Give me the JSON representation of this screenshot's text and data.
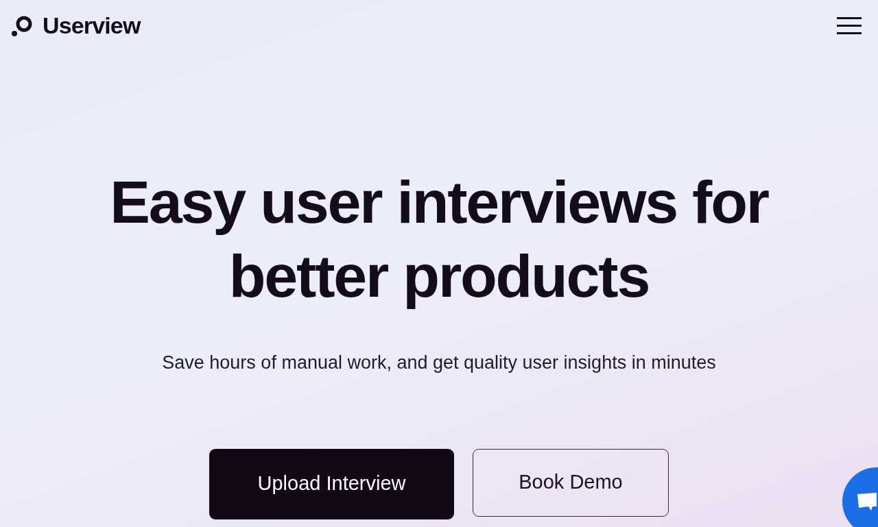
{
  "header": {
    "logo_text": "Userview"
  },
  "hero": {
    "title": "Easy user interviews for better products",
    "subtitle": "Save hours of manual work, and get quality user insights in minutes"
  },
  "buttons": [
    {
      "label": "Upload Interview",
      "kind": "primary"
    },
    {
      "label": "Book Demo",
      "kind": "secondary"
    }
  ]
}
